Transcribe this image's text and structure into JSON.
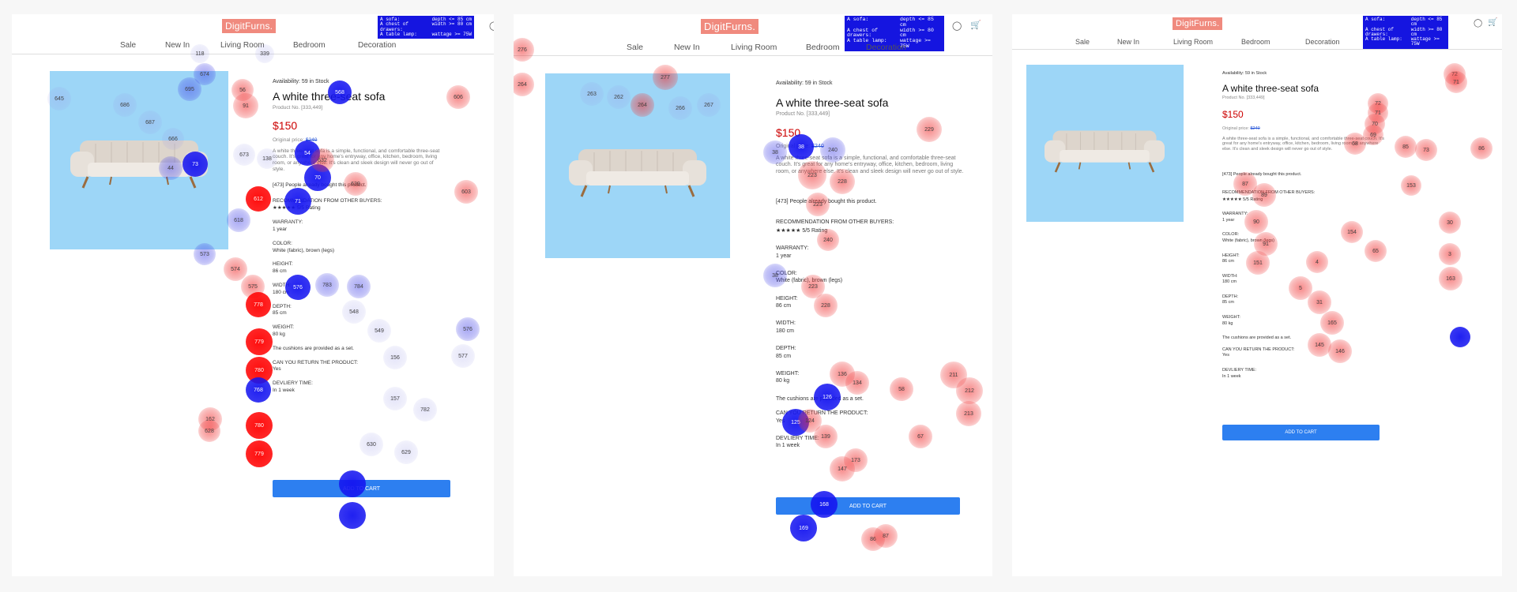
{
  "brand": {
    "name": "DigitFurns."
  },
  "spec_box": {
    "rows": [
      {
        "label": "A sofa:",
        "rule": "depth <= 85 cm"
      },
      {
        "label": "A chest of drawers:",
        "rule": "width >= 80 cm"
      },
      {
        "label": "A table lamp:",
        "rule": "wattage >= 75W"
      }
    ]
  },
  "icons": {
    "account": "account-circle-icon",
    "cart": "shopping-cart-icon"
  },
  "nav": [
    "Sale",
    "New In",
    "Living Room",
    "Bedroom",
    "Decoration"
  ],
  "product": {
    "availability": "Availability: 59 in Stock",
    "title": "A white three-seat sofa",
    "product_no": "Product No. [333,449]",
    "price": "$150",
    "original_label": "Original price:",
    "original_price": "$240",
    "description": "A white three-seat sofa is a simple, functional, and comfortable three-seat couch. It's great for any home's entryway, office, kitchen, bedroom, living room, or anywhere else. It's clean and sleek design will never go out of style.",
    "sold": "[473] People already bought this product.",
    "recommendation": "RECOMMENDATION FROM OTHER BUYERS:",
    "rating": "★★★★★ 5/5 Rating",
    "specs": [
      {
        "label": "WARRANTY:",
        "value": "1 year"
      },
      {
        "label": "COLOR:",
        "value": "White (fabric), brown (legs)"
      },
      {
        "label": "HEIGHT:",
        "value": "86 cm"
      },
      {
        "label": "WIDTH:",
        "value": "180 cm"
      },
      {
        "label": "DEPTH:",
        "value": "85 cm"
      },
      {
        "label": "WEIGHT:",
        "value": "80 kg"
      }
    ],
    "cushions": "The cushions are provided as a set.",
    "return_label": "CAN YOU RETURN THE PRODUCT:",
    "return_value": "Yes",
    "delivery_label": "DEVLIERY TIME:",
    "delivery_value": "In 1 week",
    "cart_button": "ADD TO CART"
  },
  "fixations": {
    "panel1": [
      "118",
      "339",
      "645",
      "686",
      "687",
      "666",
      "695",
      "674",
      "56",
      "91",
      "673",
      "138",
      "568",
      "54",
      "70",
      "71",
      "73",
      "44",
      "632",
      "639",
      "606",
      "603",
      "612",
      "618",
      "573",
      "574",
      "575",
      "576",
      "783",
      "784",
      "548",
      "549",
      "156",
      "157",
      "782",
      "577",
      "576",
      "778",
      "779",
      "780",
      "768",
      "162",
      "628",
      "629",
      "630"
    ],
    "panel2": [
      "276",
      "264",
      "263",
      "262",
      "264",
      "266",
      "267",
      "277",
      "38",
      "240",
      "223",
      "228",
      "229",
      "136",
      "134",
      "126",
      "125",
      "124",
      "139",
      "147",
      "173",
      "211",
      "212",
      "213",
      "58",
      "67",
      "86",
      "87",
      "168",
      "169"
    ],
    "panel3": [
      "72",
      "71",
      "70",
      "69",
      "68",
      "85",
      "73",
      "86",
      "87",
      "89",
      "90",
      "91",
      "151",
      "152",
      "153",
      "154",
      "65",
      "30",
      "3",
      "4",
      "5",
      "31",
      "163",
      "164",
      "165",
      "145",
      "146"
    ]
  }
}
